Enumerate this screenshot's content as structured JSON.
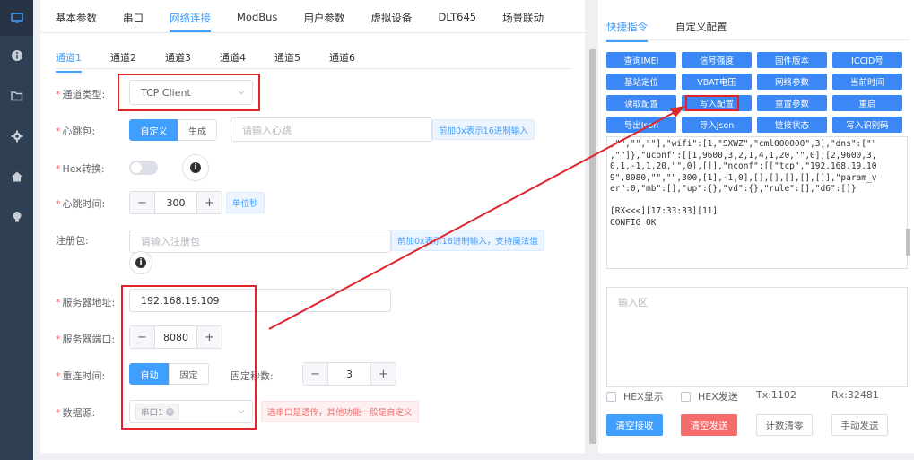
{
  "sidebar": {
    "icons": [
      "monitor-icon",
      "info-icon",
      "folder-icon",
      "gear-icon",
      "home-icon",
      "bulb-icon"
    ]
  },
  "top_tabs": [
    "基本参数",
    "串口",
    "网络连接",
    "ModBus",
    "用户参数",
    "虚拟设备",
    "DLT645",
    "场景联动"
  ],
  "top_tab_active": 2,
  "channel_tabs": [
    "通道1",
    "通道2",
    "通道3",
    "通道4",
    "通道5",
    "通道6"
  ],
  "form": {
    "channel_type_label": "通道类型:",
    "channel_type_value": "TCP Client",
    "heartbeat_label": "心跳包:",
    "heartbeat_custom": "自定义",
    "heartbeat_generate": "生成",
    "heartbeat_placeholder": "请输入心跳",
    "heartbeat_tip": "前加0x表示16进制输入",
    "hex_label": "Hex转换:",
    "heartbeat_time_label": "心跳时间:",
    "heartbeat_time_value": "300",
    "heartbeat_time_unit": "单位秒",
    "register_label": "注册包:",
    "register_placeholder": "请输入注册包",
    "register_tip": "前加0x表示16进制输入，支持魔法值",
    "server_addr_label": "服务器地址:",
    "server_addr_value": "192.168.19.109",
    "server_port_label": "服务器端口:",
    "server_port_value": "8080",
    "reconnect_label": "重连时间:",
    "reconnect_auto": "自动",
    "reconnect_fixed": "固定",
    "fixed_seconds_label": "固定秒数:",
    "fixed_seconds_value": "3",
    "datasource_label": "数据源:",
    "datasource_tag": "串口1",
    "datasource_tip": "选串口是透传，其他功能一般是自定义"
  },
  "right": {
    "tabs": [
      "快捷指令",
      "自定义配置"
    ],
    "commands": [
      "查询IMEI",
      "信号强度",
      "固件版本",
      "ICCID号",
      "基站定位",
      "VBAT电压",
      "网络参数",
      "当前时间",
      "读取配置",
      "写入配置",
      "重置参数",
      "重启",
      "导出Json",
      "导入Json",
      "链接状态",
      "写入识别码"
    ],
    "console_text": ",\"\",\"\",\"\"],\"wifi\":[1,\"SXWZ\",\"cml000000\",3],\"dns\":[\"\"\n,\"\"]},\"uconf\":[[1,9600,3,2,1,4,1,20,\"\",0],[2,9600,3,\n0,1,-1,1,20,\"\",0],[]],\"nconf\":[[\"tcp\",\"192.168.19.10\n9\",8080,\"\",\"\",300,[1],-1,0],[],[],[],[],[]],\"param_v\ner\":0,\"mb\":[],\"up\":{},\"vd\":{},\"rule\":[],\"d6\":[]}\n\n[RX<<<][17:33:33][11]\nCONFIG OK",
    "input_placeholder": "输入区",
    "hex_display": "HEX显示",
    "hex_send": "HEX发送",
    "tx": "Tx:1102",
    "rx": "Rx:32481",
    "btn_clear_recv": "清空接收",
    "btn_clear_send": "清空发送",
    "btn_reset_count": "计数清零",
    "btn_manual_send": "手动发送"
  },
  "colors": {
    "sidebar": "#2f3f54",
    "primary": "#409eff",
    "annotation_red": "#e0252a",
    "danger": "#f56c6c"
  }
}
